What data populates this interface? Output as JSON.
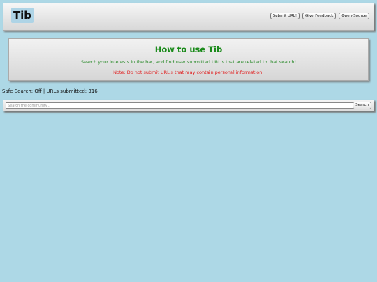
{
  "header": {
    "logo": "Tib",
    "nav": [
      "Submit URL!",
      "Give Feedback",
      "Open-Source"
    ]
  },
  "info": {
    "title": "How to use Tib",
    "description": "Search your interests in the bar, and find user submitted URL's that are related to that search!",
    "note": "Note: Do not submit URL's that may contain personal information!"
  },
  "stats": {
    "text": "Safe Search: Off | URLs submitted: 316"
  },
  "search": {
    "placeholder": "Search the community...",
    "value": "",
    "button_label": "Search"
  },
  "colors": {
    "background": "#add8e6",
    "title_green": "#1a8a1a",
    "note_red": "#e02020"
  }
}
